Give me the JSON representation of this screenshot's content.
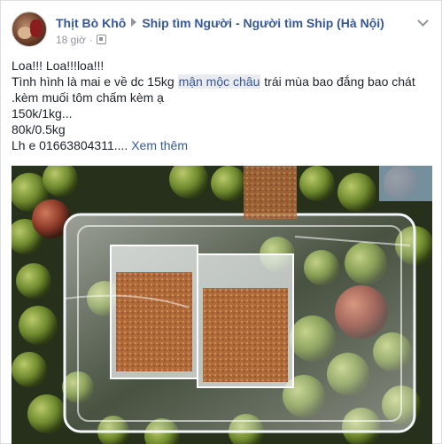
{
  "post": {
    "author": "Thịt Bò Khô",
    "group": "Ship tìm Người - Người tìm Ship (Hà Nội)",
    "time": "18 giờ",
    "separator": "·",
    "icons": {
      "privacy": "group-privacy-icon",
      "menu": "chevron-down-icon",
      "arrow": "triangle-right-icon"
    },
    "lines": [
      {
        "text": "Loa!!! Loa!!!loa!!!"
      },
      {
        "before": "Tình hình là mai e về dc 15kg ",
        "tag": "mận mộc châu",
        "after": " trái mùa bao đắng bao chát"
      },
      {
        "text": ".kèm muối tôm chấm kèm ạ"
      },
      {
        "text": "150k/1kg..."
      },
      {
        "text": "80k/0.5kg"
      },
      {
        "text": "Lh e 01663804311.... ",
        "more": "Xem thêm"
      }
    ],
    "photo": {
      "description_icon": "photo-plums-in-plastic-box",
      "colors": {
        "plum_green": "#7f9a3a",
        "plum_red": "#9e3b2c",
        "salt": "#b5703f",
        "background": "#1f2a12"
      }
    },
    "colors": {
      "link": "#365899",
      "meta": "#90949c",
      "text": "#1d2129",
      "highlight": "#e9ebee"
    }
  }
}
